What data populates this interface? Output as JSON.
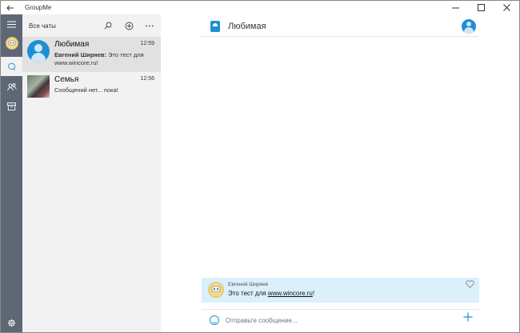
{
  "window": {
    "title": "GroupMe"
  },
  "chatlist": {
    "title": "Все чаты",
    "chats": [
      {
        "name": "Любимая",
        "time": "12:59",
        "sender": "Евгений Ширяев:",
        "preview": " Это тест для www.wincore.ru!"
      },
      {
        "name": "Семья",
        "time": "12:56",
        "sender": "",
        "preview": "Сообщений нет... пока!"
      }
    ]
  },
  "conversation": {
    "title": "Любимая",
    "messages": [
      {
        "sender": "Евгений Ширяев",
        "text_before": "Это тест для ",
        "link": "www.wincore.ru",
        "text_after": "!"
      }
    ],
    "composer_placeholder": "Отправьте сообщение..."
  }
}
